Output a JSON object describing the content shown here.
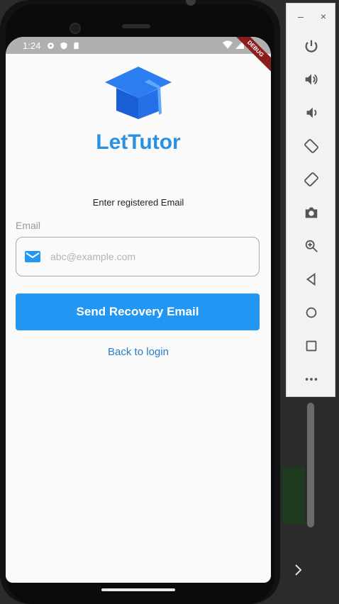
{
  "status_bar": {
    "time": "1:24",
    "debug_label": "DEBUG"
  },
  "app": {
    "title": "LetTutor",
    "subtitle": "Enter registered Email",
    "email_label": "Email",
    "email_placeholder": "abc@example.com",
    "email_value": "",
    "send_button": "Send Recovery Email",
    "back_link": "Back to login"
  },
  "emulator": {
    "minimize": "–",
    "close": "×",
    "buttons": [
      "power-icon",
      "volume-up-icon",
      "volume-down-icon",
      "rotate-left-icon",
      "rotate-right-icon",
      "camera-icon",
      "zoom-icon",
      "back-icon",
      "home-icon",
      "overview-icon",
      "more-icon"
    ]
  },
  "colors": {
    "primary": "#2196f3",
    "title": "#2a91e0",
    "link": "#2a7cc7"
  }
}
